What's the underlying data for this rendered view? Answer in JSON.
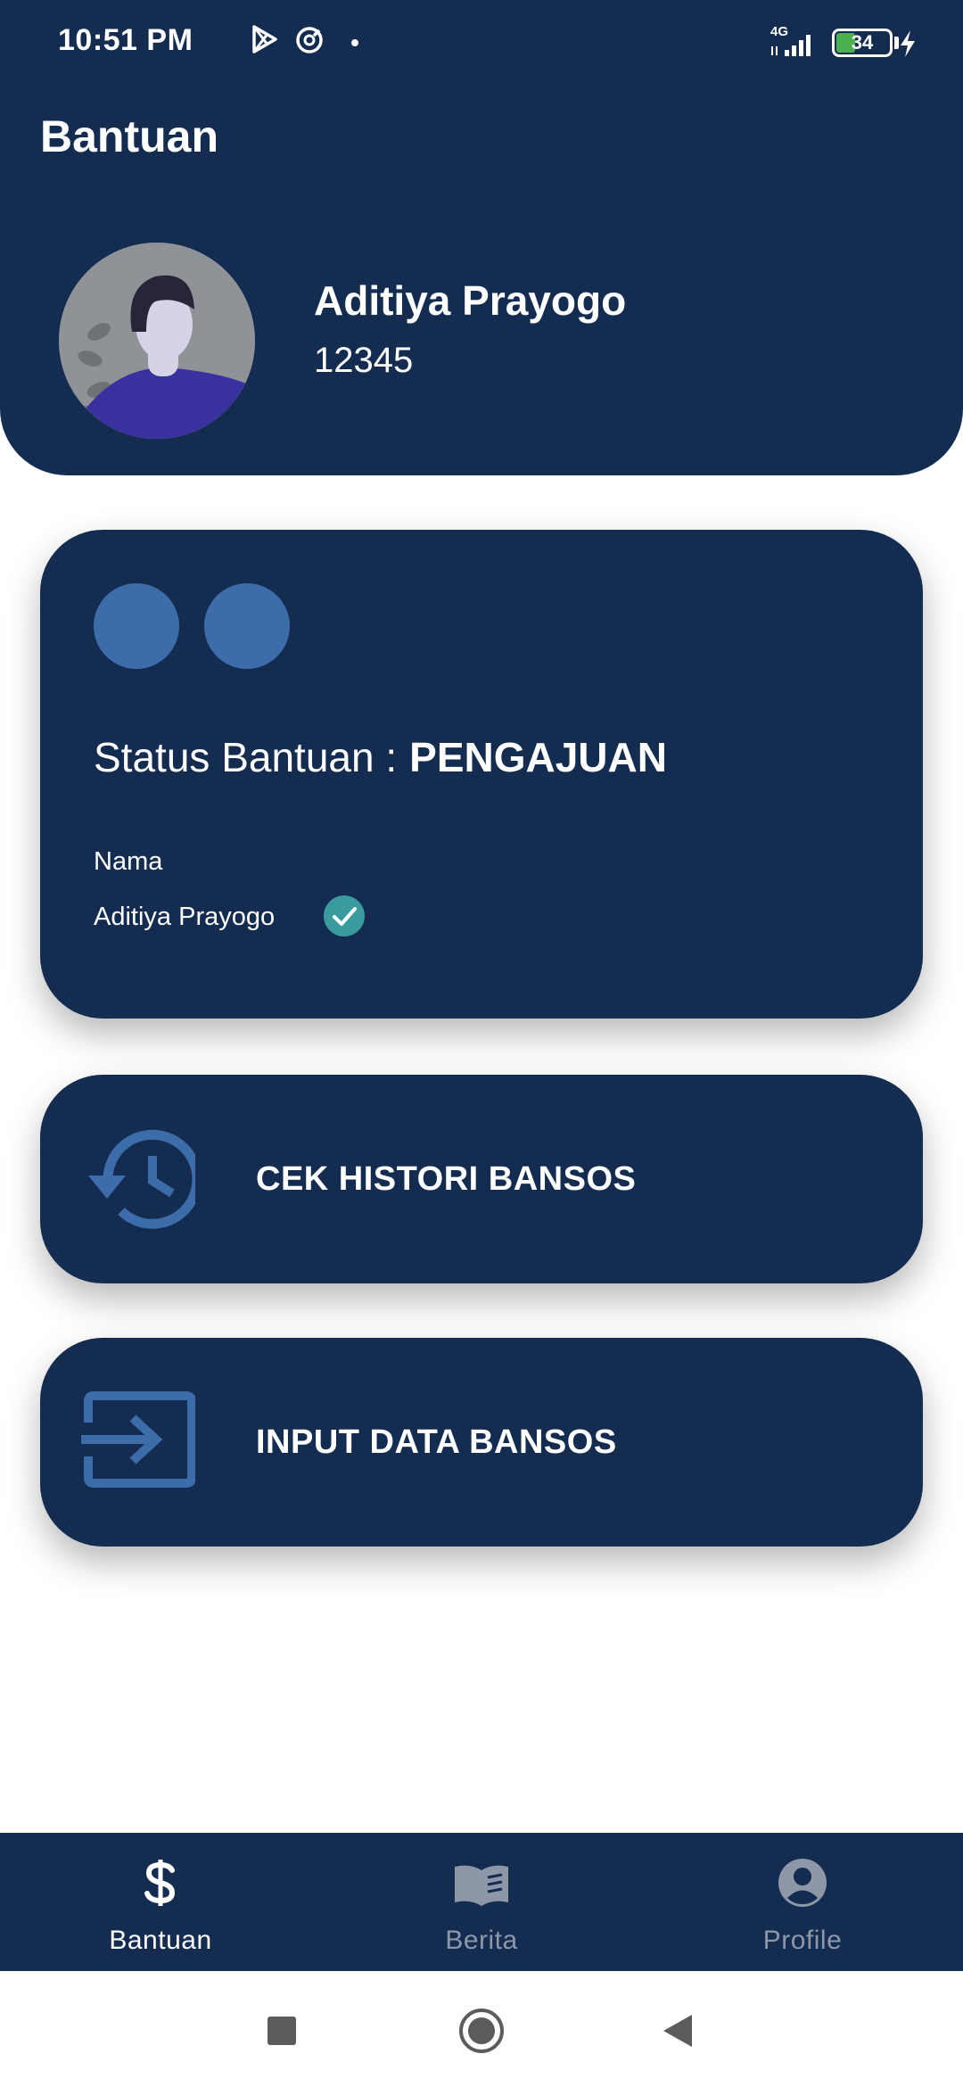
{
  "status_bar": {
    "time": "10:51 PM",
    "network": "4G",
    "battery": "34",
    "battery_level": 0.34
  },
  "app": {
    "title": "Bantuan"
  },
  "profile": {
    "name": "Aditiya Prayogo",
    "id": "12345"
  },
  "status_card": {
    "status_label": "Status Bantuan :",
    "status_value": "PENGAJUAN",
    "name_label": "Nama",
    "name_value": "Aditiya Prayogo"
  },
  "actions": {
    "histori_label": "CEK HISTORI BANSOS",
    "input_label": "INPUT DATA BANSOS"
  },
  "bottom_nav": {
    "items": [
      {
        "label": "Bantuan",
        "icon": "dollar-icon",
        "active": true
      },
      {
        "label": "Berita",
        "icon": "book-icon",
        "active": false
      },
      {
        "label": "Profile",
        "icon": "account-circle-icon",
        "active": false
      }
    ]
  },
  "colors": {
    "primary_dark": "#132c4f",
    "accent_blue": "#3d6cab",
    "check_teal": "#3a9b9e",
    "nav_inactive": "#8d97a8"
  }
}
